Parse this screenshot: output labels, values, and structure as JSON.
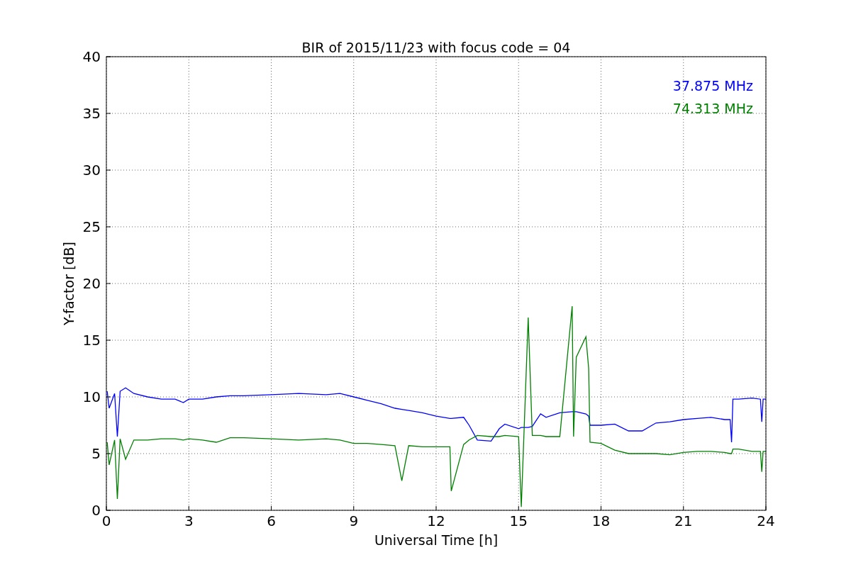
{
  "chart_data": {
    "type": "line",
    "grid": true,
    "title": "BIR of 2015/11/23 with focus code = 04",
    "xlabel": "Universal Time [h]",
    "ylabel": "Y-factor [dB]",
    "xlim": [
      0,
      24
    ],
    "ylim": [
      0,
      40
    ],
    "xticks": [
      0,
      3,
      6,
      9,
      12,
      15,
      18,
      21,
      24
    ],
    "yticks": [
      0,
      5,
      10,
      15,
      20,
      25,
      30,
      35,
      40
    ],
    "x": [
      0.03,
      0.1,
      0.3,
      0.4,
      0.5,
      0.7,
      1,
      1.5,
      2,
      2.5,
      2.8,
      3,
      3.5,
      4,
      4.5,
      5,
      6,
      7,
      8,
      8.5,
      9,
      9.5,
      10,
      10.5,
      10.75,
      11,
      11.5,
      12,
      12.5,
      12.55,
      13,
      13.2,
      13.5,
      14,
      14.3,
      14.5,
      15,
      15.1,
      15.35,
      15.5,
      15.8,
      16,
      16.5,
      16.95,
      17,
      17.1,
      17.45,
      17.55,
      17.6,
      18,
      18.5,
      19,
      19.5,
      20,
      20.5,
      21,
      21.5,
      22,
      22.5,
      22.7,
      22.75,
      22.8,
      23,
      23.5,
      23.8,
      23.85,
      23.9,
      24
    ],
    "series": [
      {
        "name": "37.875 MHz",
        "color": "#0000ff",
        "values": [
          10.5,
          9.0,
          10.3,
          6.5,
          10.5,
          10.8,
          10.3,
          10.0,
          9.8,
          9.8,
          9.5,
          9.8,
          9.8,
          10.0,
          10.1,
          10.1,
          10.2,
          10.3,
          10.2,
          10.3,
          10.0,
          9.7,
          9.4,
          9.0,
          8.9,
          8.8,
          8.6,
          8.3,
          8.1,
          8.1,
          8.2,
          7.5,
          6.2,
          6.1,
          7.2,
          7.6,
          7.2,
          7.3,
          7.3,
          7.4,
          8.5,
          8.2,
          8.6,
          8.7,
          8.7,
          8.7,
          8.5,
          8.3,
          7.5,
          7.5,
          7.6,
          7.0,
          7.0,
          7.7,
          7.8,
          8.0,
          8.1,
          8.2,
          8.0,
          8.0,
          6.0,
          9.8,
          9.8,
          9.9,
          9.8,
          7.8,
          9.8,
          9.8
        ]
      },
      {
        "name": "74.313 MHz",
        "color": "#008000",
        "values": [
          6.0,
          4.0,
          6.2,
          1.0,
          6.3,
          4.5,
          6.2,
          6.2,
          6.3,
          6.3,
          6.2,
          6.3,
          6.2,
          6.0,
          6.4,
          6.4,
          6.3,
          6.2,
          6.3,
          6.2,
          5.9,
          5.9,
          5.8,
          5.7,
          2.6,
          5.7,
          5.6,
          5.6,
          5.6,
          1.7,
          5.8,
          6.2,
          6.6,
          6.5,
          6.5,
          6.6,
          6.5,
          0.3,
          17.0,
          6.6,
          6.6,
          6.5,
          6.5,
          18.0,
          6.5,
          13.5,
          15.3,
          12.5,
          6.0,
          5.9,
          5.3,
          5.0,
          5.0,
          5.0,
          4.9,
          5.1,
          5.2,
          5.2,
          5.1,
          5.0,
          5.0,
          5.4,
          5.4,
          5.2,
          5.2,
          3.4,
          5.2,
          5.2
        ]
      }
    ]
  }
}
